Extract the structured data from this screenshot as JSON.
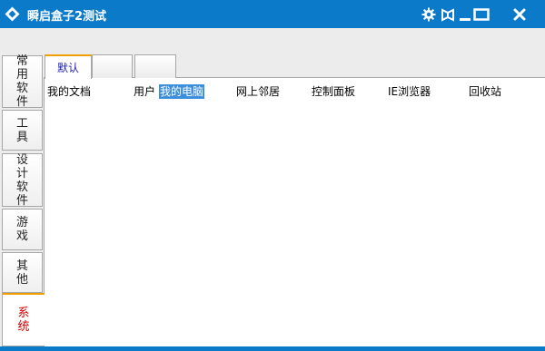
{
  "window": {
    "title": "瞬启盒子2测试",
    "accent_color": "#0a7ac9",
    "icons": [
      "app-logo-icon",
      "gear-icon",
      "skin-icon",
      "minimize-icon",
      "maximize-icon",
      "close-icon"
    ]
  },
  "side_tabs": [
    {
      "label": "常用软件",
      "active": false
    },
    {
      "label": "工具",
      "active": false
    },
    {
      "label": "设计软件",
      "active": false
    },
    {
      "label": "游戏",
      "active": false
    },
    {
      "label": "其他",
      "active": false
    },
    {
      "label": "系统",
      "active": true
    }
  ],
  "top_tabs": [
    {
      "label": "默认",
      "active": true
    },
    {
      "label": "",
      "active": false
    },
    {
      "label": "",
      "active": false
    }
  ],
  "items": [
    {
      "label": "我的文档",
      "selected": false
    },
    {
      "label": "用户",
      "selected": false
    },
    {
      "label": "我的电脑",
      "selected": true
    },
    {
      "label": "网上邻居",
      "selected": false
    },
    {
      "label": "控制面板",
      "selected": false
    },
    {
      "label": "IE浏览器",
      "selected": false
    },
    {
      "label": "回收站",
      "selected": false
    }
  ]
}
